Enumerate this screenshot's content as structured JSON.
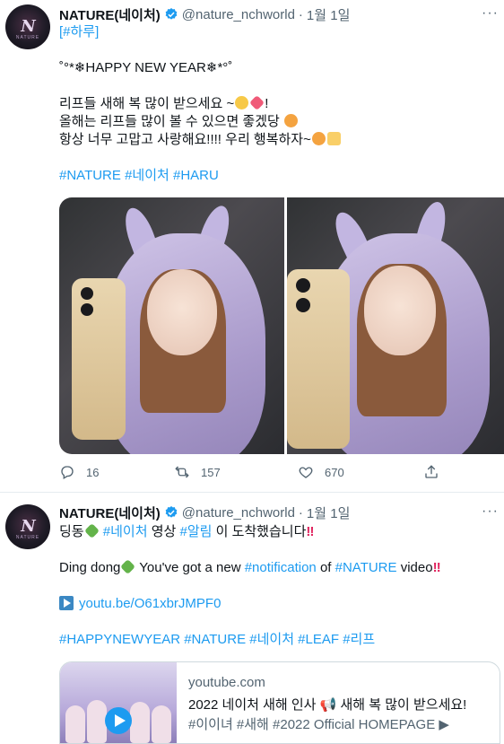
{
  "tweets": [
    {
      "author_name": "NATURE(네이처)",
      "handle": "@nature_nchworld",
      "separator": "·",
      "date": "1월 1일",
      "more": "···",
      "avatar": {
        "logo": "N",
        "sub": "NATURE"
      },
      "tag_line": "[#하루]",
      "greeting": "˚°*❄HAPPY NEW YEAR❄*°˚",
      "msg1": "리프들 새해 복 많이 받으세요 ~",
      "msg1_end": "!",
      "msg2": "올해는 리프들 많이 볼 수 있으면 좋겠당",
      "msg3": "항상 너무 고맙고 사랑해요!!!! 우리 행복하자~",
      "hashtags": "#NATURE #네이처 #HARU",
      "replies": "16",
      "retweets": "157",
      "likes": "670"
    },
    {
      "author_name": "NATURE(네이처)",
      "handle": "@nature_nchworld",
      "separator": "·",
      "date": "1월 1일",
      "more": "···",
      "avatar": {
        "logo": "N",
        "sub": "NATURE"
      },
      "l1_a": "딩동",
      "l1_tag1": "#네이처",
      "l1_b": "영상",
      "l1_tag2": "#알림",
      "l1_c": "이 도착했습니다",
      "l1_mark": "‼",
      "l2_a": "Ding dong",
      "l2_b": "You've got a new",
      "l2_tag1": "#notification",
      "l2_c": "of",
      "l2_tag2": "#NATURE",
      "l2_d": "video",
      "l2_mark": "‼",
      "yt_link": "youtu.be/O61xbrJMPF0",
      "hashtags": "#HAPPYNEWYEAR #NATURE #네이처 #LEAF #리프",
      "card": {
        "domain": "youtube.com",
        "title": "2022 네이처 새해 인사 📢 새해 복 많이 받으세요!",
        "desc": "#이이녀 #새해 #2022 Official HOMEPAGE ▶"
      }
    }
  ],
  "colors": {
    "link": "#1d9bf0",
    "muted": "#536471",
    "verified": "#1d9bf0"
  },
  "icons": [
    "verified-badge-icon",
    "reply-icon",
    "retweet-icon",
    "like-icon",
    "share-icon",
    "more-icon",
    "play-icon"
  ]
}
